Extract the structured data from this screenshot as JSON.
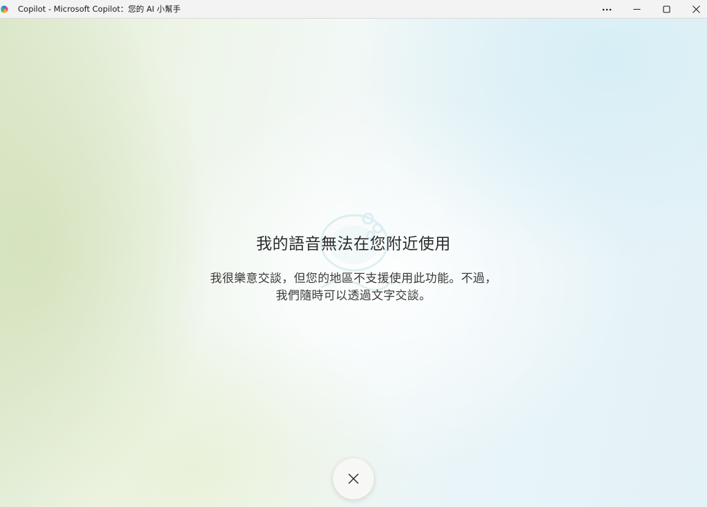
{
  "window": {
    "title": "Copilot - Microsoft Copilot：您的 AI 小幫手",
    "app_icon": "copilot-logo-icon",
    "controls": {
      "more": "more-options-icon",
      "minimize": "minimize-icon",
      "maximize": "maximize-icon",
      "close": "close-icon"
    }
  },
  "voice_message": {
    "headline": "我的語音無法在您附近使用",
    "body": "我很樂意交談，但您的地區不支援使用此功能。不過，我們隨時可以透過文字交談。"
  },
  "dismiss_button": {
    "icon": "close-icon"
  },
  "colors": {
    "accent_bg_green": "#dde8cc",
    "accent_bg_blue": "#e3f2f7",
    "text_primary": "#2b2b2b"
  }
}
